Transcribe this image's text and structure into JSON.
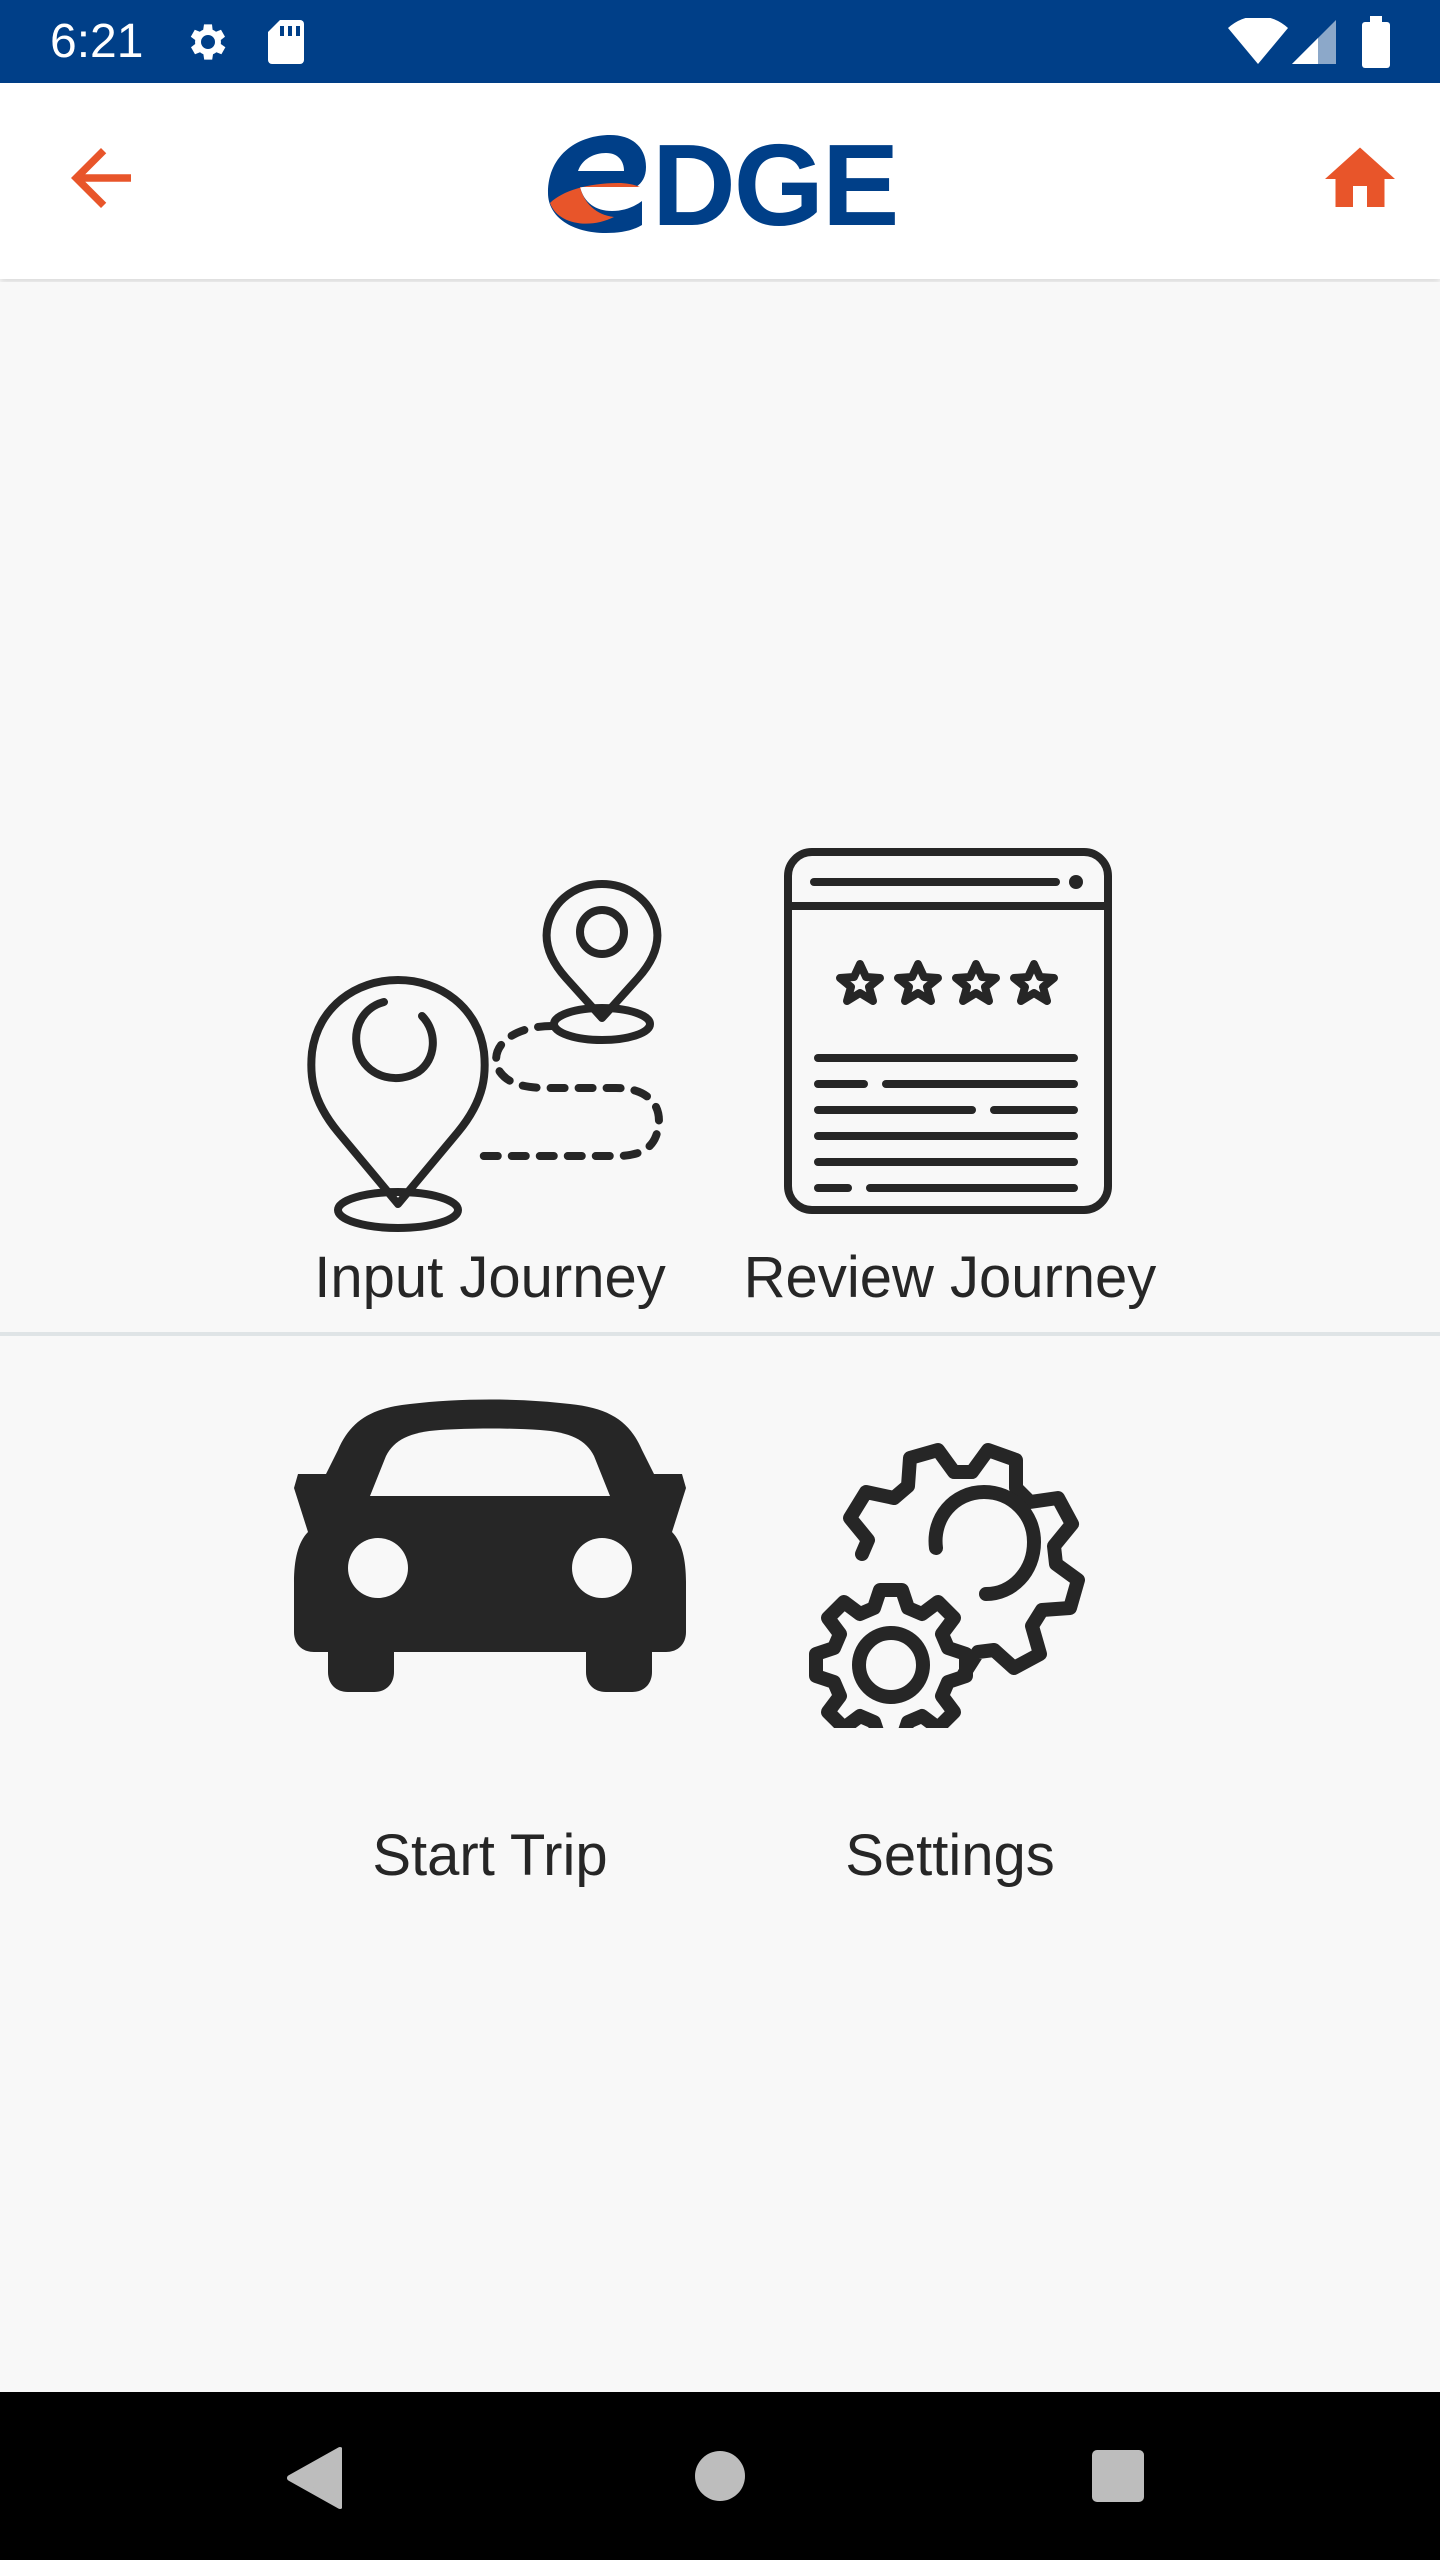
{
  "status_bar": {
    "time": "6:21",
    "icons": [
      "settings-icon",
      "sd-card-icon",
      "wifi-icon",
      "signal-icon",
      "battery-icon"
    ]
  },
  "app_bar": {
    "logo_text": "eDGE",
    "back_icon": "arrow-left-icon",
    "home_icon": "home-icon",
    "accent_color": "#e8552a",
    "brand_color": "#003f88"
  },
  "menu": {
    "tiles": [
      {
        "label": "Input Journey",
        "icon": "map-route-icon"
      },
      {
        "label": "Review Journey",
        "icon": "review-document-icon"
      },
      {
        "label": "Start Trip",
        "icon": "car-icon"
      },
      {
        "label": "Settings",
        "icon": "gears-icon"
      }
    ]
  },
  "nav_bar": {
    "icons": [
      "back-triangle-icon",
      "home-circle-icon",
      "recents-square-icon"
    ]
  }
}
